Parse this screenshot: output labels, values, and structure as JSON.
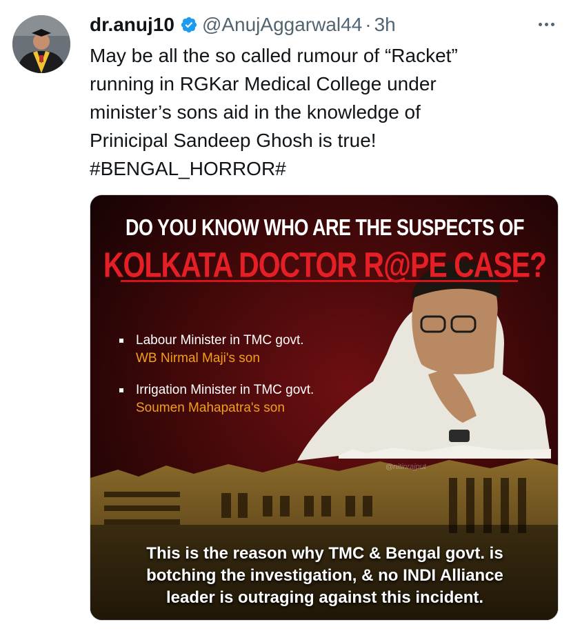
{
  "tweet": {
    "display_name": "dr.anuj10",
    "handle": "@AnujAggarwal44",
    "separator": "·",
    "time": "3h",
    "text_lines": [
      "May be all the so called rumour of  “Racket”",
      "running in RGKar Medical College under",
      "minister’s sons aid in the knowledge of",
      "Prinicipal Sandeep Ghosh is true!",
      "#BENGAL_HORROR#"
    ]
  },
  "media": {
    "headline_line1": "DO YOU KNOW WHO ARE THE SUSPECTS OF",
    "headline_line2": "KOLKATA DOCTOR R@PE CASE?",
    "bullets": [
      {
        "line1": "Labour Minister in TMC govt.",
        "line2": "WB Nirmal Maji's son"
      },
      {
        "line1": "Irrigation Minister in TMC govt.",
        "line2": "Soumen Mahapatra's son"
      }
    ],
    "watermark": "@nitinrajput",
    "caption_lines": [
      "This is the reason why TMC & Bengal govt. is",
      "botching the investigation, & no INDI Alliance",
      "leader is outraging against this incident."
    ]
  },
  "colors": {
    "verified_blue": "#1d9bf0",
    "headline_red": "#e41f26",
    "bullet_orange": "#f2a01a",
    "muted_text": "#536471"
  },
  "icons": {
    "verified": "verified-badge-icon",
    "more": "more-options-icon"
  }
}
